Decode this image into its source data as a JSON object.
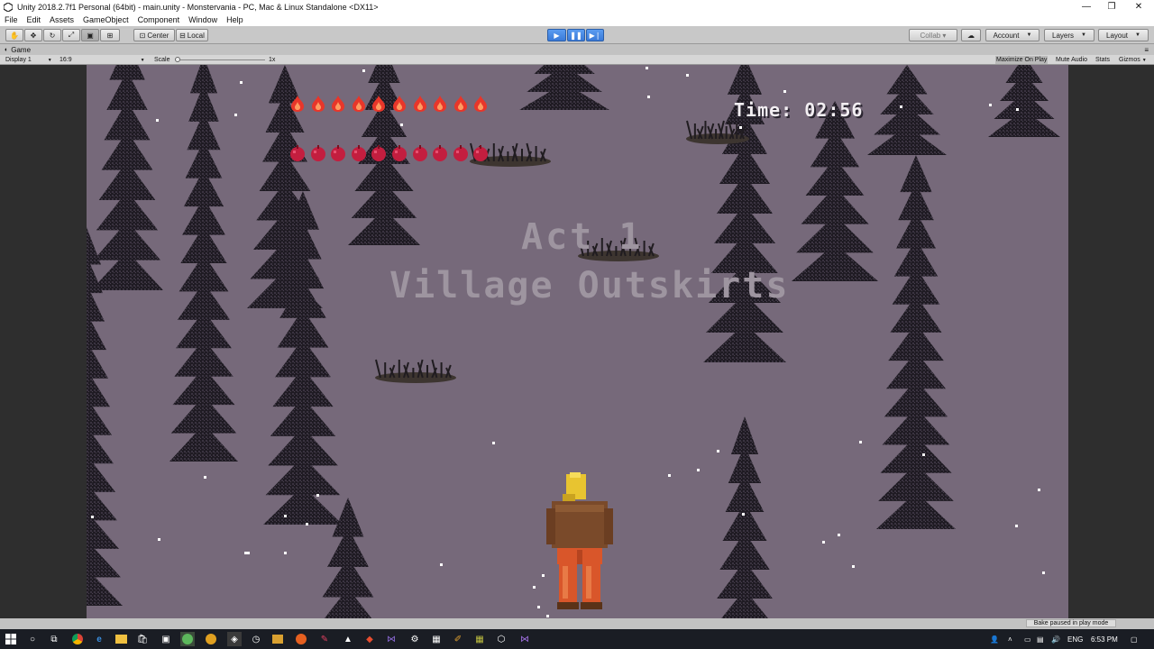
{
  "window": {
    "title": "Unity 2018.2.7f1 Personal (64bit) - main.unity - Monstervania - PC, Mac & Linux Standalone <DX11>",
    "minimize": "—",
    "maximize": "❐",
    "close": "✕"
  },
  "menu": [
    "File",
    "Edit",
    "Assets",
    "GameObject",
    "Component",
    "Window",
    "Help"
  ],
  "toolbar": {
    "pivot_label": "Center",
    "space_label": "Local",
    "collab_label": "Collab ▾",
    "account_label": "Account",
    "layers_label": "Layers",
    "layout_label": "Layout"
  },
  "game_tab": {
    "tab_label": "Game",
    "display": "Display 1",
    "aspect": "16:9",
    "scale_label": "Scale",
    "scale_value": "1x",
    "maximize_on_play": "Maximize On Play",
    "mute_audio": "Mute Audio",
    "stats": "Stats",
    "gizmos": "Gizmos"
  },
  "game": {
    "timer": "Time: 02:56",
    "act_title": "Act 1",
    "act_subtitle": "Village Outskirts",
    "health_max": 10,
    "health_current": 10,
    "mana_max": 10,
    "mana_current": 10,
    "colors": {
      "ground": "#76697a",
      "tree": "#1f1b23",
      "fire": "#e8362a",
      "orb": "#c31e3f"
    }
  },
  "status": {
    "bake_message": "Bake paused in play mode"
  },
  "taskbar": {
    "language": "ENG",
    "time": "6:53 PM"
  }
}
